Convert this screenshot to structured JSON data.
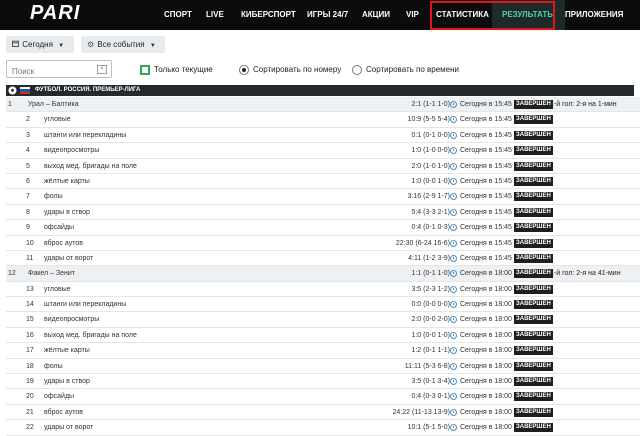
{
  "brand": {
    "logo_text": "PARI"
  },
  "nav": {
    "items": [
      {
        "label": "СПОРТ"
      },
      {
        "label": "LIVE"
      },
      {
        "label": "КИБЕРСПОРТ"
      },
      {
        "label": "ИГРЫ 24/7"
      },
      {
        "label": "АКЦИИ"
      },
      {
        "label": "VIP"
      },
      {
        "label": "СТАТИСТИКА"
      },
      {
        "label": "РЕЗУЛЬТАТЫ"
      },
      {
        "label": "ПРИЛОЖЕНИЯ"
      }
    ],
    "active": "РЕЗУЛЬТАТЫ",
    "accent_color": "#4bd6a1",
    "highlight_box_color": "#e0161f"
  },
  "filters": {
    "date": {
      "label": "Сегодня",
      "icon": "calendar-icon"
    },
    "events": {
      "label": "Все события",
      "icon": "gear-icon"
    },
    "search": {
      "placeholder": "Поиск",
      "value": ""
    },
    "only_current": {
      "label": "Только текущие",
      "checked": false
    },
    "sort_by_number": {
      "label": "Сортировать по номеру",
      "selected": true
    },
    "sort_by_time": {
      "label": "Сортировать по времени",
      "selected": false
    }
  },
  "league": {
    "title": "ФУТБОЛ. РОССИЯ. ПРЕМЬЕР-ЛИГА",
    "flag_colors": [
      "#ffffff",
      "#1c57a5",
      "#d52b1e"
    ]
  },
  "rows": [
    {
      "num": "1",
      "name": "Урал – Балтика",
      "score": "2:1 (1-1 1-0)",
      "time": "Сегодня в 15:45",
      "status": "ЗАВЕРШЕН",
      "goal": "1-й гол: 2-я на 1-мин",
      "main": true
    },
    {
      "num": "2",
      "name": "угловые",
      "score": "10:9 (5-5 5-4)",
      "time": "Сегодня в 15:45",
      "status": "ЗАВЕРШЕН",
      "goal": "",
      "main": false
    },
    {
      "num": "3",
      "name": "штанги или перекладины",
      "score": "0:1 (0-1 0-0)",
      "time": "Сегодня в 15:45",
      "status": "ЗАВЕРШЕН",
      "goal": "",
      "main": false
    },
    {
      "num": "4",
      "name": "видеопросмотры",
      "score": "1:0 (1-0 0-0)",
      "time": "Сегодня в 15:45",
      "status": "ЗАВЕРШЕН",
      "goal": "",
      "main": false
    },
    {
      "num": "5",
      "name": "выход мед. бригады на поле",
      "score": "2:0 (1-0 1-0)",
      "time": "Сегодня в 15:45",
      "status": "ЗАВЕРШЕН",
      "goal": "",
      "main": false
    },
    {
      "num": "6",
      "name": "жёлтые карты",
      "score": "1:0 (0-0 1-0)",
      "time": "Сегодня в 15:45",
      "status": "ЗАВЕРШЕН",
      "goal": "",
      "main": false
    },
    {
      "num": "7",
      "name": "фолы",
      "score": "3:16 (2-9 1-7)",
      "time": "Сегодня в 15:45",
      "status": "ЗАВЕРШЕН",
      "goal": "",
      "main": false
    },
    {
      "num": "8",
      "name": "удары в створ",
      "score": "5:4 (3-3 2-1)",
      "time": "Сегодня в 15:45",
      "status": "ЗАВЕРШЕН",
      "goal": "",
      "main": false
    },
    {
      "num": "9",
      "name": "офсайды",
      "score": "0:4 (0-1 0-3)",
      "time": "Сегодня в 15:45",
      "status": "ЗАВЕРШЕН",
      "goal": "",
      "main": false
    },
    {
      "num": "10",
      "name": "вброс аутов",
      "score": "22:30 (6-24 16-6)",
      "time": "Сегодня в 15:45",
      "status": "ЗАВЕРШЕН",
      "goal": "",
      "main": false
    },
    {
      "num": "11",
      "name": "удары от ворот",
      "score": "4:11 (1-2 3-9)",
      "time": "Сегодня в 15:45",
      "status": "ЗАВЕРШЕН",
      "goal": "",
      "main": false
    },
    {
      "num": "12",
      "name": "Факел – Зенит",
      "score": "1:1 (0-1 1-0)",
      "time": "Сегодня в 18:00",
      "status": "ЗАВЕРШЕН",
      "goal": "1-й гол: 2-я на 41-мин",
      "main": true
    },
    {
      "num": "13",
      "name": "угловые",
      "score": "3:5 (2-3 1-2)",
      "time": "Сегодня в 18:00",
      "status": "ЗАВЕРШЕН",
      "goal": "",
      "main": false
    },
    {
      "num": "14",
      "name": "штанги или перекладины",
      "score": "0:0 (0-0 0-0)",
      "time": "Сегодня в 18:00",
      "status": "ЗАВЕРШЕН",
      "goal": "",
      "main": false
    },
    {
      "num": "15",
      "name": "видеопросмотры",
      "score": "2:0 (0-0 2-0)",
      "time": "Сегодня в 18:00",
      "status": "ЗАВЕРШЕН",
      "goal": "",
      "main": false
    },
    {
      "num": "16",
      "name": "выход мед. бригады на поле",
      "score": "1:0 (0-0 1-0)",
      "time": "Сегодня в 18:00",
      "status": "ЗАВЕРШЕН",
      "goal": "",
      "main": false
    },
    {
      "num": "17",
      "name": "жёлтые карты",
      "score": "1:2 (0-1 1-1)",
      "time": "Сегодня в 18:00",
      "status": "ЗАВЕРШЕН",
      "goal": "",
      "main": false
    },
    {
      "num": "18",
      "name": "фолы",
      "score": "11:11 (5-3 6-8)",
      "time": "Сегодня в 18:00",
      "status": "ЗАВЕРШЕН",
      "goal": "",
      "main": false
    },
    {
      "num": "19",
      "name": "удары в створ",
      "score": "3:5 (0-1 3-4)",
      "time": "Сегодня в 18:00",
      "status": "ЗАВЕРШЕН",
      "goal": "",
      "main": false
    },
    {
      "num": "20",
      "name": "офсайды",
      "score": "0:4 (0-3 0-1)",
      "time": "Сегодня в 18:00",
      "status": "ЗАВЕРШЕН",
      "goal": "",
      "main": false
    },
    {
      "num": "21",
      "name": "вброс аутов",
      "score": "24:22 (11-13 13-9)",
      "time": "Сегодня в 18:00",
      "status": "ЗАВЕРШЕН",
      "goal": "",
      "main": false
    },
    {
      "num": "22",
      "name": "удары от ворот",
      "score": "10:1 (5-1 5-0)",
      "time": "Сегодня в 18:00",
      "status": "ЗАВЕРШЕН",
      "goal": "",
      "main": false
    }
  ]
}
